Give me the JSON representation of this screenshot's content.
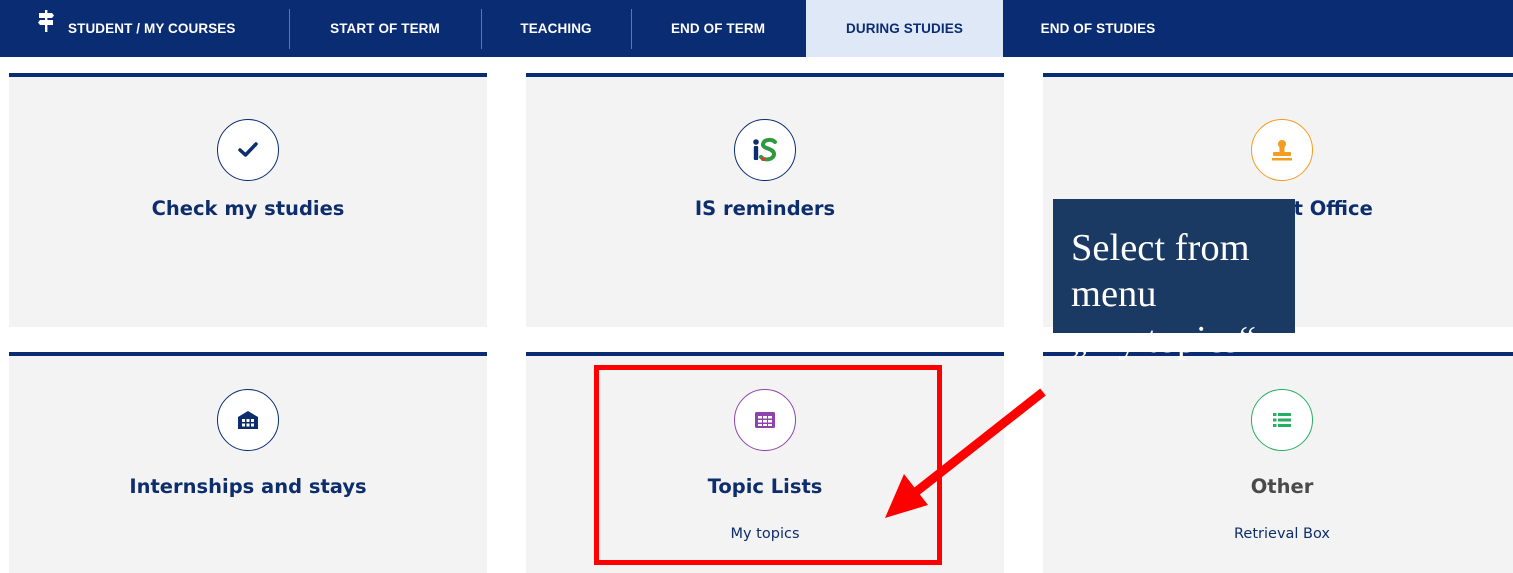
{
  "nav": {
    "items": [
      {
        "label": "STUDENT / MY COURSES"
      },
      {
        "label": "START OF TERM"
      },
      {
        "label": "TEACHING"
      },
      {
        "label": "END OF TERM"
      },
      {
        "label": "DURING STUDIES",
        "active": true
      },
      {
        "label": "END OF STUDIES"
      }
    ]
  },
  "tiles": [
    {
      "title": "Check my studies",
      "icon": "checkmark-icon",
      "color": "#0a2c73"
    },
    {
      "title": "IS reminders",
      "icon": "is-logo-icon",
      "color": "#0a2c73"
    },
    {
      "title": "Document Office",
      "icon": "stamp-icon",
      "color": "#f39c1f"
    },
    {
      "title": "Internships and stays",
      "icon": "building-icon",
      "color": "#0a2c73"
    },
    {
      "title": "Topic Lists",
      "subtitle": "My topics",
      "icon": "table-icon",
      "color": "#8e44ad"
    },
    {
      "title": "Other",
      "subtitle": "Retrieval Box",
      "icon": "list-icon",
      "color": "#27ae60"
    }
  ],
  "callout": {
    "line1": "Select from menu",
    "line2": "„my topics“"
  },
  "colors": {
    "nav_bg": "#0a2c73",
    "nav_active_bg": "#dfe8f6",
    "tile_bg": "#f3f3f3",
    "callout_bg": "#1b3a63",
    "highlight": "#ff0000"
  }
}
